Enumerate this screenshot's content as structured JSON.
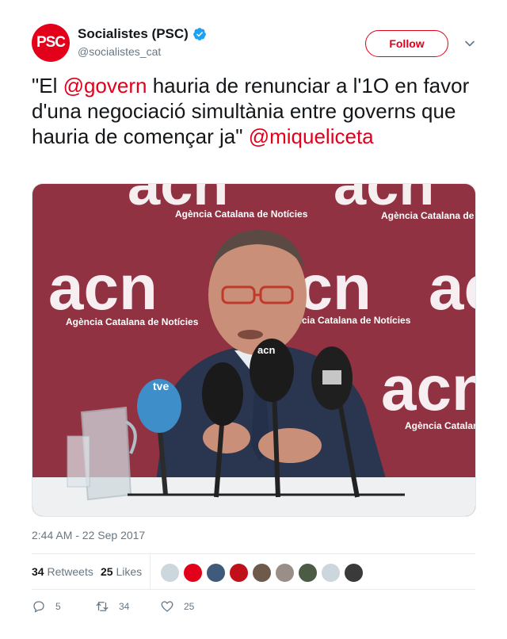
{
  "author": {
    "display_name": "Socialistes (PSC)",
    "handle": "@socialistes_cat",
    "avatar_text": "PSC",
    "verified": true
  },
  "follow_label": "Follow",
  "tweet": {
    "segments": [
      {
        "text": "\"El ",
        "mention": false
      },
      {
        "text": "@govern",
        "mention": true
      },
      {
        "text": "  hauria de renunciar a l'1O en favor d'una negociació simultània entre governs que hauria de començar ja\" ",
        "mention": false
      },
      {
        "text": "@miqueliceta",
        "mention": true
      }
    ]
  },
  "photo": {
    "backdrop_word": "acn",
    "backdrop_caption": "Agència Catalana de Notícies",
    "mic_labels": [
      "tve",
      "acn"
    ]
  },
  "timestamp": "2:44 AM - 22 Sep 2017",
  "stats": {
    "retweets_count": "34",
    "retweets_label": "Retweets",
    "likes_count": "25",
    "likes_label": "Likes"
  },
  "actions": {
    "reply_count": "5",
    "retweet_count": "34",
    "like_count": "25"
  },
  "colors": {
    "accent": "#e2001a",
    "backdrop": "#8a2e3e",
    "secondary_text": "#657786"
  }
}
